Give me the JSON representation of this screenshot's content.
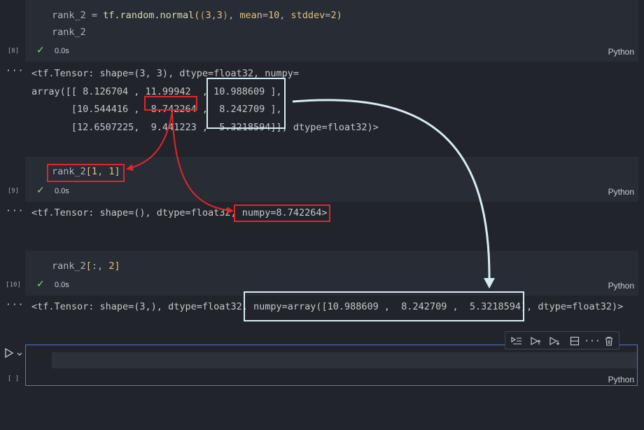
{
  "cells": [
    {
      "exec_count": "[8]",
      "code_lines": {
        "l1": {
          "var": "rank_2",
          "eq": " = ",
          "call": "tf.random.normal",
          "p1": "(",
          "p2": "(",
          "a1": "3",
          "c1": ",",
          "a2": "3",
          "p3": ")",
          "c2": ", ",
          "kw1": "mean",
          "e1": "=",
          "v1": "10",
          "c3": ", ",
          "kw2": "stddev",
          "e2": "=",
          "v2": "2",
          "p4": ")"
        },
        "l2": "rank_2"
      },
      "status": "0.0s",
      "language": "Python",
      "output_lines": [
        "<tf.Tensor: shape=(3, 3), dtype=float32, numpy=",
        "array([[ 8.126704 , 11.99942  , 10.988609 ],",
        "       [10.544416 ,  8.742264 ,  8.242709 ],",
        "       [12.6507225,  9.441223 ,  5.3218594]], dtype=float32)>"
      ]
    },
    {
      "exec_count": "[9]",
      "code": {
        "var": "rank_2",
        "b1": "[",
        "i1": "1",
        "c": ", ",
        "i2": "1",
        "b2": "]"
      },
      "status": "0.0s",
      "language": "Python",
      "output": "<tf.Tensor: shape=(), dtype=float32, numpy=8.742264>"
    },
    {
      "exec_count": "[10]",
      "code": {
        "var": "rank_2",
        "b1": "[",
        "s": ":, ",
        "i": "2",
        "b2": "]"
      },
      "status": "0.0s",
      "language": "Python",
      "output": "<tf.Tensor: shape=(3,), dtype=float32, numpy=array([10.988609 ,  8.242709 ,  5.3218594], dtype=float32)>"
    },
    {
      "exec_count": "[ ]",
      "language": "Python"
    }
  ],
  "output_more_label": "···",
  "toolbar": {
    "icons": [
      "run-by-line-icon",
      "execute-above-icon",
      "execute-below-icon",
      "split-cell-icon",
      "more-actions-icon",
      "delete-cell-icon"
    ],
    "more_label": "···"
  },
  "colors": {
    "highlight_red": "#e0262c",
    "highlight_blue": "#d6ecf5",
    "success_check": "#89d185",
    "selected_cell_border": "#4d78cc"
  }
}
